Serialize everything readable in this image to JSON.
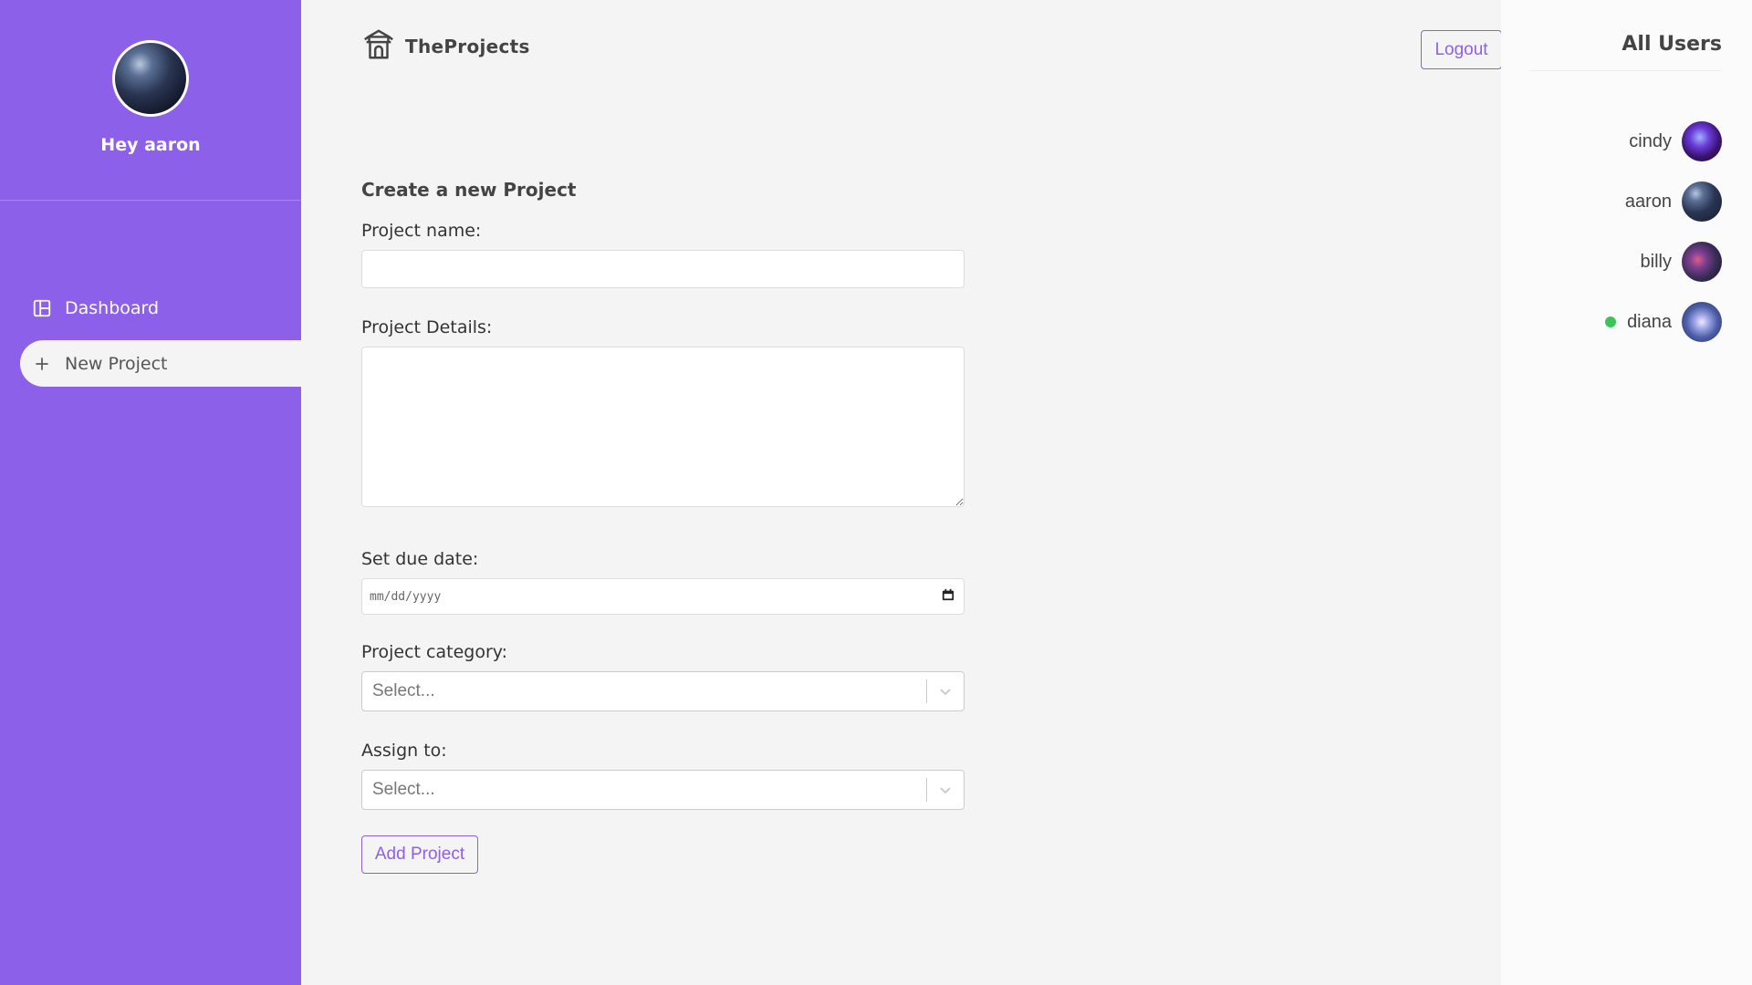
{
  "sidebar": {
    "greeting": "Hey aaron",
    "nav": [
      {
        "label": "Dashboard",
        "icon": "dashboard-icon",
        "active": false
      },
      {
        "label": "New Project",
        "icon": "plus-icon",
        "active": true
      }
    ]
  },
  "header": {
    "brand": "TheProjects",
    "logo_icon": "temple-icon",
    "logout_label": "Logout"
  },
  "form": {
    "title": "Create a new Project",
    "name_label": "Project name:",
    "name_value": "",
    "details_label": "Project Details:",
    "details_value": "",
    "due_label": "Set due date:",
    "due_placeholder": "mm/dd/yyyy",
    "category_label": "Project category:",
    "category_placeholder": "Select...",
    "assign_label": "Assign to:",
    "assign_placeholder": "Select...",
    "submit_label": "Add Project"
  },
  "users_panel": {
    "title": "All Users",
    "users": [
      {
        "name": "cindy",
        "online": false
      },
      {
        "name": "aaron",
        "online": false
      },
      {
        "name": "billy",
        "online": false
      },
      {
        "name": "diana",
        "online": true
      }
    ]
  },
  "colors": {
    "accent": "#8d60ea",
    "online": "#3bc45a",
    "background": "#f4f4f4"
  }
}
